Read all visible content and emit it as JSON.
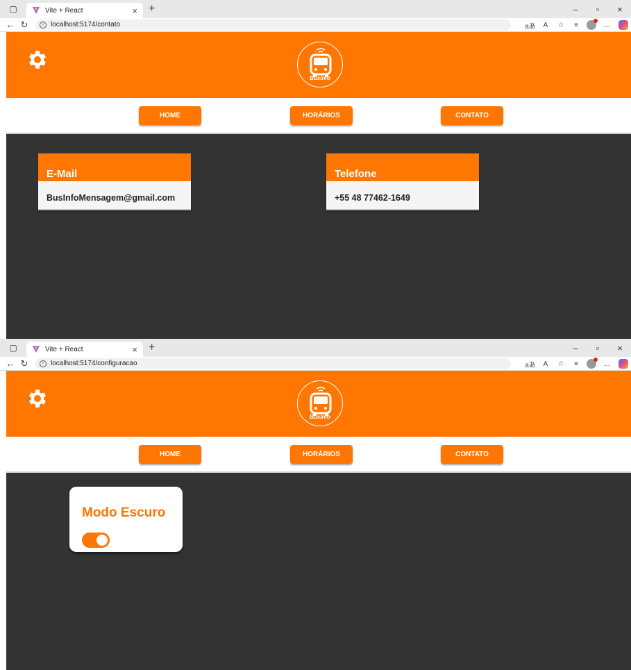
{
  "colors": {
    "brand_orange": "#ff7600",
    "content_bg": "#333333",
    "navbar_bg": "#ffffff"
  },
  "windows": [
    {
      "tab": {
        "title": "Vite + React",
        "close": "×",
        "new_tab": "+"
      },
      "url": "localhost:5174/contato",
      "window_controls": {
        "minimize": "–",
        "restore": "▫",
        "close": "×"
      },
      "header": {
        "settings_icon": "gear-icon",
        "logo_text": "BusInfo"
      },
      "nav": {
        "home": "HOME",
        "horarios": "HORÁRIOS",
        "contato": "CONTATO"
      },
      "contact": {
        "email_title": "E-Mail",
        "email_value": "BusInfoMensagem@gmail.com",
        "phone_title": "Telefone",
        "phone_value": "+55 48 77462-1649"
      }
    },
    {
      "tab": {
        "title": "Vite + React",
        "close": "×",
        "new_tab": "+"
      },
      "url": "localhost:5174/configuracao",
      "window_controls": {
        "minimize": "–",
        "restore": "▫",
        "close": "×"
      },
      "header": {
        "settings_icon": "gear-icon",
        "logo_text": "BusInfo"
      },
      "nav": {
        "home": "HOME",
        "horarios": "HORÁRIOS",
        "contato": "CONTATO"
      },
      "settings": {
        "dark_mode_label": "Modo Escuro",
        "dark_mode_on": true
      }
    }
  ]
}
